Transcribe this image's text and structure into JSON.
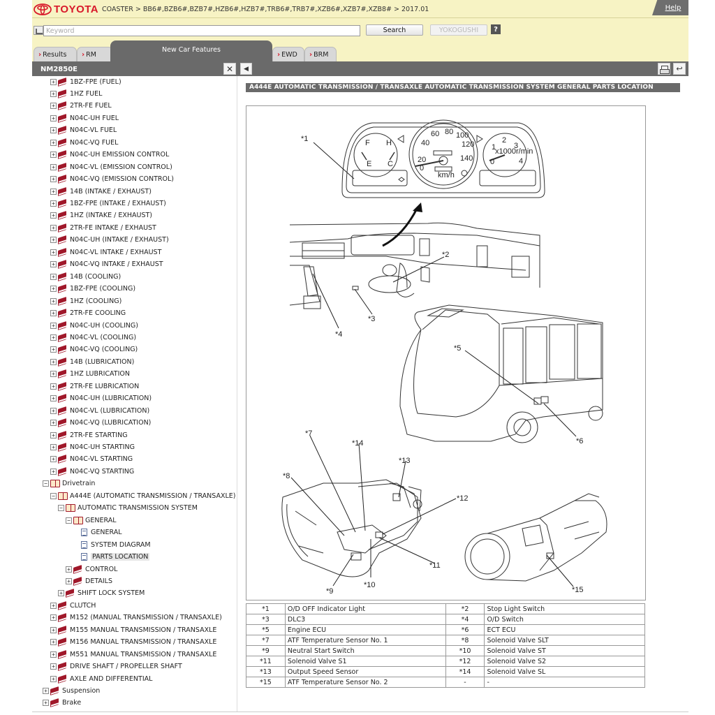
{
  "header": {
    "logo_text": "TOYOTA",
    "breadcrumb": "COASTER > BB6#,BZB6#,BZB7#,HZB6#,HZB7#,TRB6#,TRB7#,XZB6#,XZB7#,XZB8# > 2017.01",
    "help_label": "Help"
  },
  "search": {
    "placeholder": "Keyword",
    "search_label": "Search",
    "yokogushi_label": "YOKOGUSHI",
    "question_label": "?"
  },
  "tabs": [
    {
      "label": "Results"
    },
    {
      "label": "RM"
    },
    {
      "label": "New Car Features"
    },
    {
      "label": "EWD"
    },
    {
      "label": "BRM"
    }
  ],
  "left_panel": {
    "title": "NM2850E",
    "close_label": "✕",
    "tree": [
      {
        "label": "1BZ-FPE (FUEL)",
        "level": 2,
        "toggle": "+",
        "icon": "book"
      },
      {
        "label": "1HZ FUEL",
        "level": 2,
        "toggle": "+",
        "icon": "book"
      },
      {
        "label": "2TR-FE FUEL",
        "level": 2,
        "toggle": "+",
        "icon": "book"
      },
      {
        "label": "N04C-UH FUEL",
        "level": 2,
        "toggle": "+",
        "icon": "book"
      },
      {
        "label": "N04C-VL FUEL",
        "level": 2,
        "toggle": "+",
        "icon": "book"
      },
      {
        "label": "N04C-VQ FUEL",
        "level": 2,
        "toggle": "+",
        "icon": "book"
      },
      {
        "label": "N04C-UH EMISSION CONTROL",
        "level": 2,
        "toggle": "+",
        "icon": "book"
      },
      {
        "label": "N04C-VL (EMISSION CONTROL)",
        "level": 2,
        "toggle": "+",
        "icon": "book"
      },
      {
        "label": "N04C-VQ (EMISSION CONTROL)",
        "level": 2,
        "toggle": "+",
        "icon": "book"
      },
      {
        "label": "14B (INTAKE / EXHAUST)",
        "level": 2,
        "toggle": "+",
        "icon": "book"
      },
      {
        "label": "1BZ-FPE (INTAKE / EXHAUST)",
        "level": 2,
        "toggle": "+",
        "icon": "book"
      },
      {
        "label": "1HZ (INTAKE / EXHAUST)",
        "level": 2,
        "toggle": "+",
        "icon": "book"
      },
      {
        "label": "2TR-FE INTAKE / EXHAUST",
        "level": 2,
        "toggle": "+",
        "icon": "book"
      },
      {
        "label": "N04C-UH (INTAKE / EXHAUST)",
        "level": 2,
        "toggle": "+",
        "icon": "book"
      },
      {
        "label": "N04C-VL INTAKE / EXHAUST",
        "level": 2,
        "toggle": "+",
        "icon": "book"
      },
      {
        "label": "N04C-VQ INTAKE / EXHAUST",
        "level": 2,
        "toggle": "+",
        "icon": "book"
      },
      {
        "label": "14B (COOLING)",
        "level": 2,
        "toggle": "+",
        "icon": "book"
      },
      {
        "label": "1BZ-FPE (COOLING)",
        "level": 2,
        "toggle": "+",
        "icon": "book"
      },
      {
        "label": "1HZ (COOLING)",
        "level": 2,
        "toggle": "+",
        "icon": "book"
      },
      {
        "label": "2TR-FE COOLING",
        "level": 2,
        "toggle": "+",
        "icon": "book"
      },
      {
        "label": "N04C-UH (COOLING)",
        "level": 2,
        "toggle": "+",
        "icon": "book"
      },
      {
        "label": "N04C-VL (COOLING)",
        "level": 2,
        "toggle": "+",
        "icon": "book"
      },
      {
        "label": "N04C-VQ (COOLING)",
        "level": 2,
        "toggle": "+",
        "icon": "book"
      },
      {
        "label": "14B (LUBRICATION)",
        "level": 2,
        "toggle": "+",
        "icon": "book"
      },
      {
        "label": "1HZ LUBRICATION",
        "level": 2,
        "toggle": "+",
        "icon": "book"
      },
      {
        "label": "2TR-FE LUBRICATION",
        "level": 2,
        "toggle": "+",
        "icon": "book"
      },
      {
        "label": "N04C-UH (LUBRICATION)",
        "level": 2,
        "toggle": "+",
        "icon": "book"
      },
      {
        "label": "N04C-VL (LUBRICATION)",
        "level": 2,
        "toggle": "+",
        "icon": "book"
      },
      {
        "label": "N04C-VQ (LUBRICATION)",
        "level": 2,
        "toggle": "+",
        "icon": "book"
      },
      {
        "label": "2TR-FE STARTING",
        "level": 2,
        "toggle": "+",
        "icon": "book"
      },
      {
        "label": "N04C-UH STARTING",
        "level": 2,
        "toggle": "+",
        "icon": "book"
      },
      {
        "label": "N04C-VL STARTING",
        "level": 2,
        "toggle": "+",
        "icon": "book"
      },
      {
        "label": "N04C-VQ STARTING",
        "level": 2,
        "toggle": "+",
        "icon": "book"
      },
      {
        "label": "Drivetrain",
        "level": 1,
        "toggle": "−",
        "icon": "open"
      },
      {
        "label": "A444E (AUTOMATIC TRANSMISSION / TRANSAXLE)",
        "level": 2,
        "toggle": "−",
        "icon": "open"
      },
      {
        "label": "AUTOMATIC TRANSMISSION SYSTEM",
        "level": 3,
        "toggle": "−",
        "icon": "open"
      },
      {
        "label": "GENERAL",
        "level": 4,
        "toggle": "−",
        "icon": "open"
      },
      {
        "label": "GENERAL",
        "level": 5,
        "toggle": "",
        "icon": "doc"
      },
      {
        "label": "SYSTEM DIAGRAM",
        "level": 5,
        "toggle": "",
        "icon": "doc"
      },
      {
        "label": "PARTS LOCATION",
        "level": 5,
        "toggle": "",
        "icon": "doc",
        "selected": true
      },
      {
        "label": "CONTROL",
        "level": 4,
        "toggle": "+",
        "icon": "book"
      },
      {
        "label": "DETAILS",
        "level": 4,
        "toggle": "+",
        "icon": "book"
      },
      {
        "label": "SHIFT LOCK SYSTEM",
        "level": 3,
        "toggle": "+",
        "icon": "book"
      },
      {
        "label": "CLUTCH",
        "level": 2,
        "toggle": "+",
        "icon": "book"
      },
      {
        "label": "M152 (MANUAL TRANSMISSION / TRANSAXLE)",
        "level": 2,
        "toggle": "+",
        "icon": "book"
      },
      {
        "label": "M155 MANUAL TRANSMISSION / TRANSAXLE",
        "level": 2,
        "toggle": "+",
        "icon": "book"
      },
      {
        "label": "M156 MANUAL TRANSMISSION / TRANSAXLE",
        "level": 2,
        "toggle": "+",
        "icon": "book"
      },
      {
        "label": "M551 MANUAL TRANSMISSION / TRANSAXLE",
        "level": 2,
        "toggle": "+",
        "icon": "book"
      },
      {
        "label": "DRIVE SHAFT / PROPELLER SHAFT",
        "level": 2,
        "toggle": "+",
        "icon": "book"
      },
      {
        "label": "AXLE AND DIFFERENTIAL",
        "level": 2,
        "toggle": "+",
        "icon": "book"
      },
      {
        "label": "Suspension",
        "level": 1,
        "toggle": "+",
        "icon": "book"
      },
      {
        "label": "Brake",
        "level": 1,
        "toggle": "+",
        "icon": "book"
      }
    ]
  },
  "right_panel": {
    "back_label": "◀",
    "exit_label": "↩",
    "doc_title": "A444E AUTOMATIC TRANSMISSION / TRANSAXLE  AUTOMATIC TRANSMISSION SYSTEM  GENERAL  PARTS LOCATION",
    "callouts": [
      "*1",
      "*2",
      "*3",
      "*4",
      "*5",
      "*6",
      "*7",
      "*8",
      "*9",
      "*10",
      "*11",
      "*12",
      "*13",
      "*14",
      "*15"
    ],
    "speedo_ticks": [
      "20",
      "40",
      "60",
      "80",
      "100",
      "120",
      "140",
      "0"
    ],
    "tacho_ticks": [
      "0",
      "1",
      "2",
      "3",
      "4"
    ],
    "fuel_marks": [
      "F",
      "E",
      "H",
      "C"
    ],
    "kmh_label": "km/h",
    "x1000_label": "x1000r/min",
    "parts": [
      [
        "*1",
        "O/D OFF Indicator Light",
        "*2",
        "Stop Light Switch"
      ],
      [
        "*3",
        "DLC3",
        "*4",
        "O/D Switch"
      ],
      [
        "*5",
        "Engine ECU",
        "*6",
        "ECT ECU"
      ],
      [
        "*7",
        "ATF Temperature Sensor No. 1",
        "*8",
        "Solenoid Valve SLT"
      ],
      [
        "*9",
        "Neutral Start Switch",
        "*10",
        "Solenoid Valve ST"
      ],
      [
        "*11",
        "Solenoid Valve S1",
        "*12",
        "Solenoid Valve S2"
      ],
      [
        "*13",
        "Output Speed Sensor",
        "*14",
        "Solenoid Valve SL"
      ],
      [
        "*15",
        "ATF Temperature Sensor No. 2",
        "-",
        "-"
      ]
    ]
  }
}
